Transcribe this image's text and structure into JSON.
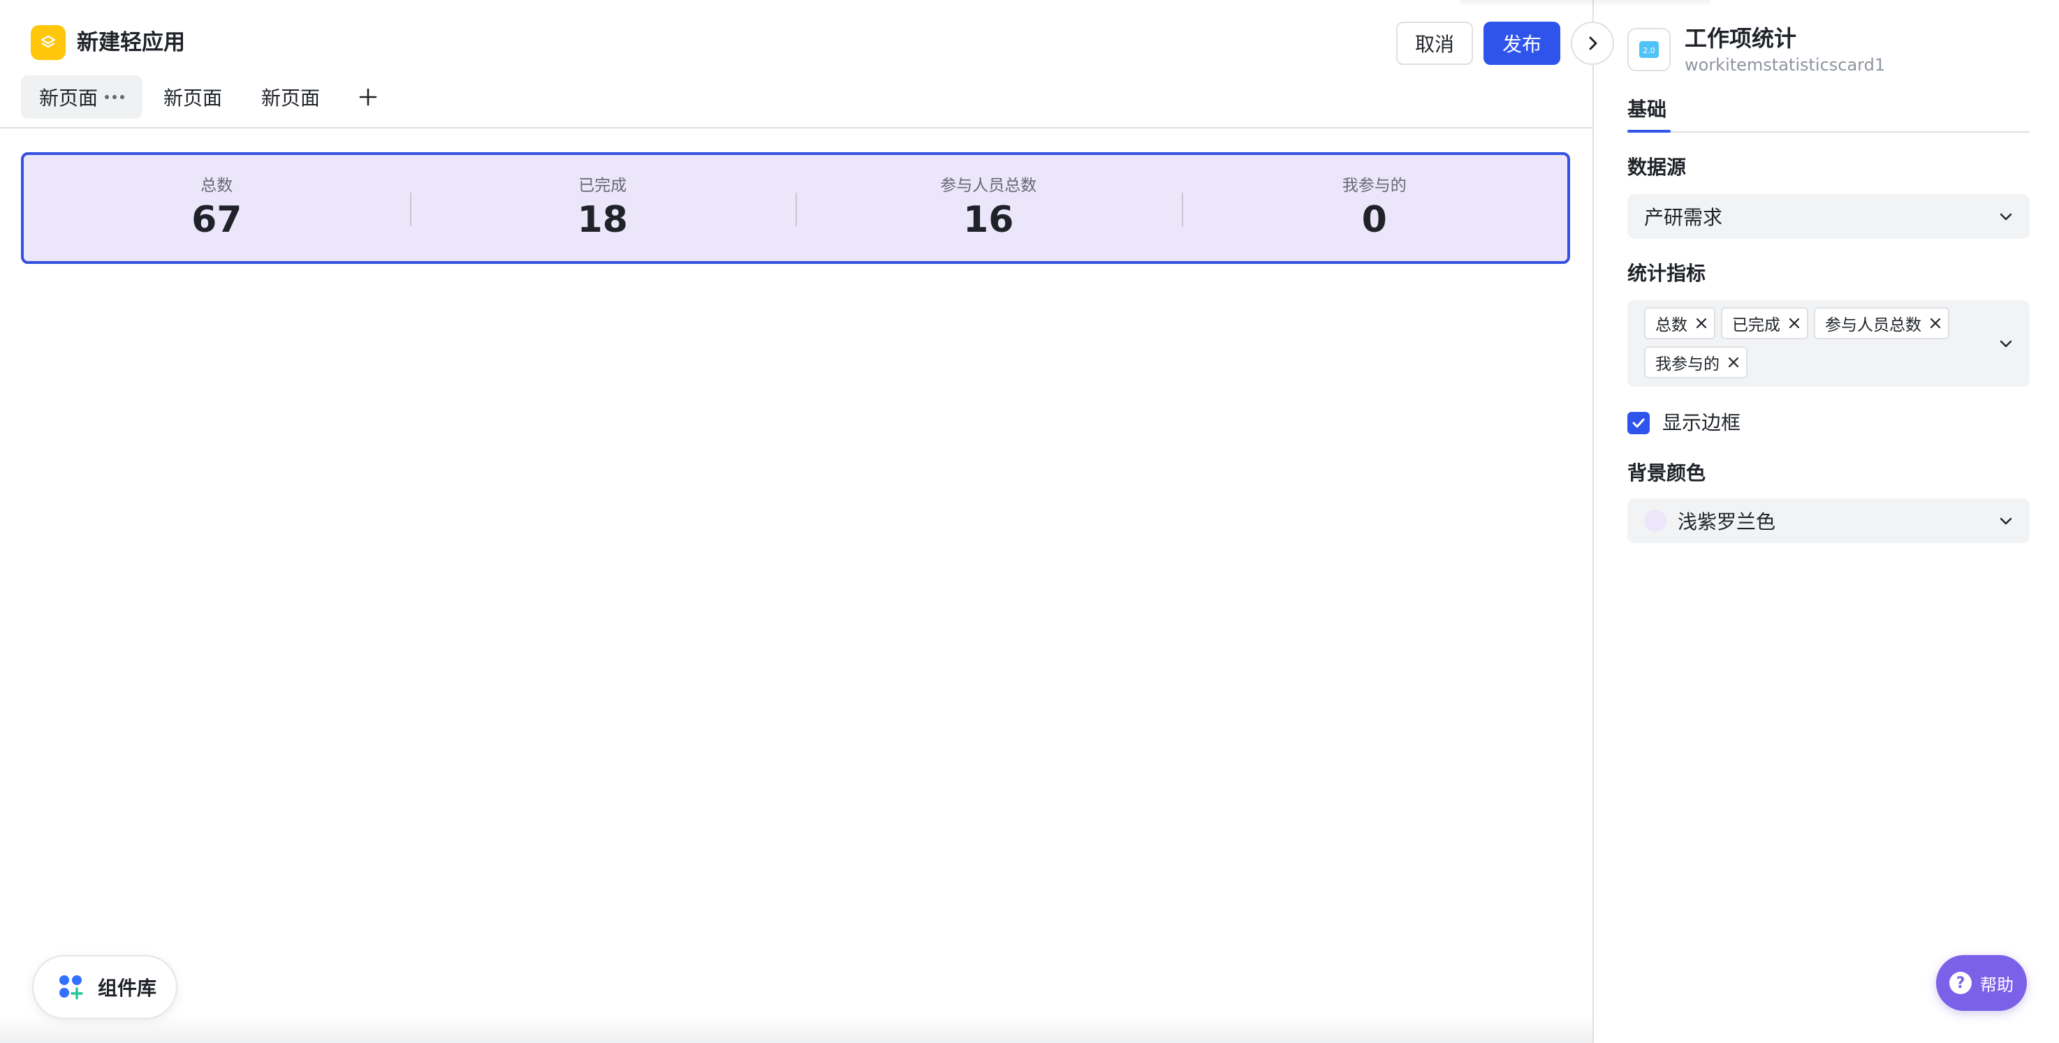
{
  "app": {
    "title": "新建轻应用",
    "logo_color": "#ffc60a"
  },
  "tabs": [
    {
      "label": "新页面",
      "active": true
    },
    {
      "label": "新页面",
      "active": false
    },
    {
      "label": "新页面",
      "active": false
    }
  ],
  "header": {
    "cancel_label": "取消",
    "publish_label": "发布",
    "accent_color": "#2f54eb"
  },
  "stats_card": {
    "background": "#ece6fb",
    "items": [
      {
        "label": "总数",
        "value": "67"
      },
      {
        "label": "已完成",
        "value": "18"
      },
      {
        "label": "参与人员总数",
        "value": "16"
      },
      {
        "label": "我参与的",
        "value": "0"
      }
    ]
  },
  "component_library": {
    "label": "组件库"
  },
  "panel": {
    "title": "工作项统计",
    "subtitle": "workitemstatisticscard1",
    "icon_text": "2.0",
    "tab_label": "基础",
    "data_source": {
      "label": "数据源",
      "value": "产研需求"
    },
    "metrics": {
      "label": "统计指标",
      "chips": [
        "总数",
        "已完成",
        "参与人员总数",
        "我参与的"
      ]
    },
    "show_border": {
      "label": "显示边框",
      "checked": true
    },
    "background_color": {
      "label": "背景颜色",
      "value": "浅紫罗兰色",
      "swatch": "#ece6fb"
    }
  },
  "help": {
    "label": "帮助",
    "color": "#7b61e8"
  }
}
